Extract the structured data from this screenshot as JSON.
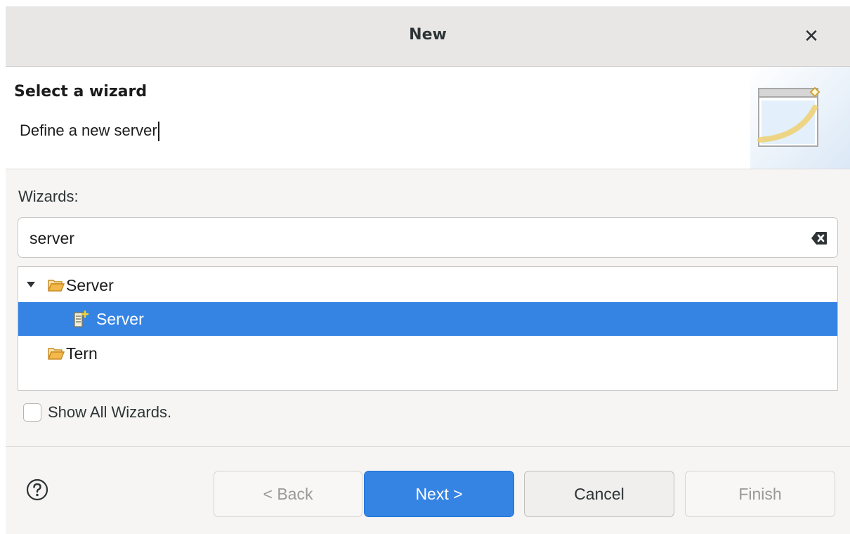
{
  "dialog": {
    "title": "New",
    "close_icon": "close-icon"
  },
  "header": {
    "title": "Select a wizard",
    "message": "Define a new server",
    "image_icon": "new-wizard-banner-icon"
  },
  "wizards": {
    "label": "Wizards:",
    "filter_value": "server",
    "clear_icon": "clear-text-icon",
    "tree": [
      {
        "label": "Server",
        "icon": "folder-open-icon",
        "expanded": true,
        "depth": 0
      },
      {
        "label": "Server",
        "icon": "new-server-icon",
        "selected": true,
        "depth": 1
      },
      {
        "label": "Tern",
        "icon": "folder-open-icon",
        "depth": 0
      }
    ],
    "show_all_label": "Show All Wizards.",
    "show_all_checked": false
  },
  "footer": {
    "help_icon": "help-icon",
    "back_label": "< Back",
    "next_label": "Next >",
    "cancel_label": "Cancel",
    "finish_label": "Finish"
  },
  "colors": {
    "accent": "#3584e4",
    "folder": "#e8a33d"
  }
}
